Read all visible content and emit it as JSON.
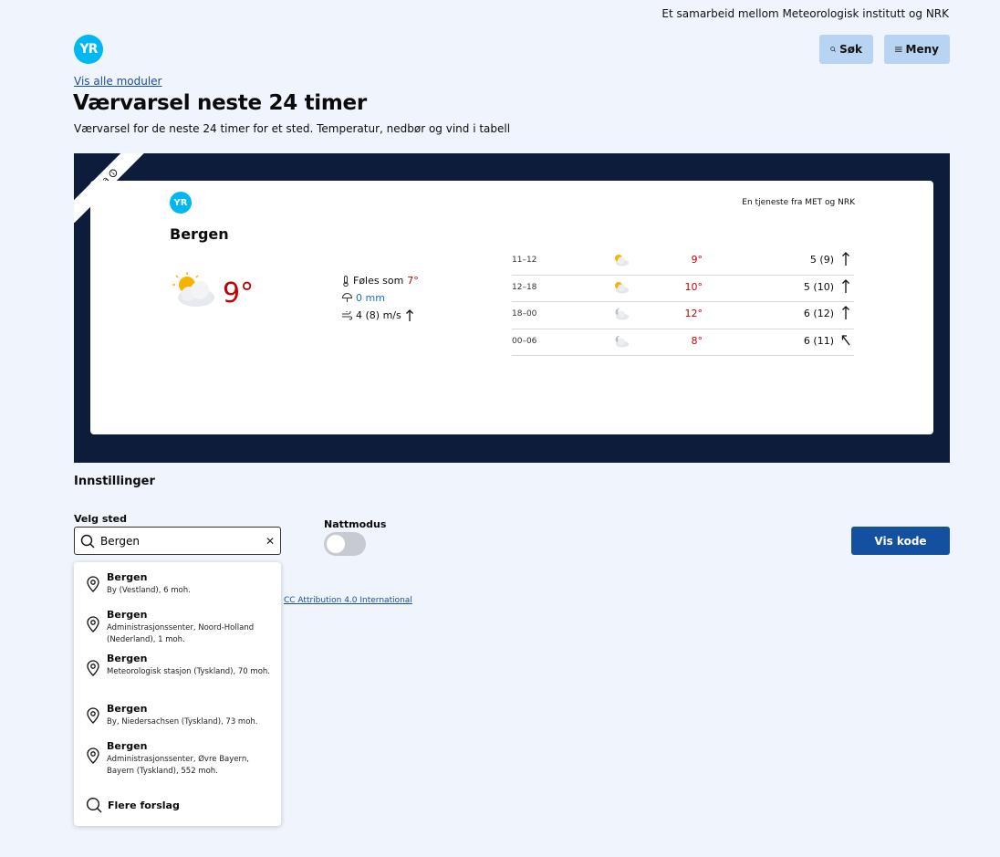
{
  "header": {
    "collab": "Et samarbeid mellom Meteorologisk institutt og NRK",
    "logo": "YR",
    "search_label": "Søk",
    "menu_label": "Meny"
  },
  "breadcrumb": "Vis alle moduler",
  "page": {
    "title": "Værvarsel neste 24 timer",
    "subtitle": "Værvarsel for de neste 24 timer for et sted. Temperatur, nedbør og vind i tabell"
  },
  "widget": {
    "beta_label": "Beta",
    "logo": "YR",
    "service": "En tjeneste fra MET og NRK",
    "place": "Bergen",
    "now_temp": "9°",
    "feels_label": "Føles som",
    "feels_value": "7°",
    "precip": "0 mm",
    "wind": "4 (8) m/s",
    "forecast": [
      {
        "time": "11–12",
        "symbol": "partly-cloudy-day",
        "temp": "9°",
        "wind": "5 (9)",
        "wind_dir": "north"
      },
      {
        "time": "12–18",
        "symbol": "partly-cloudy-day",
        "temp": "10°",
        "wind": "5 (10)",
        "wind_dir": "north"
      },
      {
        "time": "18–00",
        "symbol": "partly-cloudy-night",
        "temp": "12°",
        "wind": "6 (12)",
        "wind_dir": "north"
      },
      {
        "time": "00–06",
        "symbol": "partly-cloudy-night",
        "temp": "8°",
        "wind": "6 (11)",
        "wind_dir": "north-west"
      }
    ],
    "colors": {
      "temp": "#c60000",
      "precip": "#1a6ed8",
      "frame": "#0d1c3a"
    }
  },
  "settings": {
    "heading": "Innstillinger",
    "place_label": "Velg sted",
    "place_value": "Bergen",
    "night_label": "Nattmodus",
    "night_on": false,
    "show_code": "Vis kode",
    "license_link": "CC Attribution 4.0 International"
  },
  "suggestions": [
    {
      "name": "Bergen",
      "desc": "By (Vestland), 6 moh."
    },
    {
      "name": "Bergen",
      "desc": "Administrasjonssenter, Noord-Holland (Nederland), 1 moh."
    },
    {
      "name": "Bergen",
      "desc": "Meteorologisk stasjon (Tyskland), 70 moh."
    },
    {
      "name": "Bergen",
      "desc": "By, Niedersachsen (Tyskland), 73 moh."
    },
    {
      "name": "Bergen",
      "desc": "Administrasjonssenter, Øvre Bayern, Bayern (Tyskland), 552 moh."
    }
  ],
  "more_suggestions": "Flere forslag"
}
